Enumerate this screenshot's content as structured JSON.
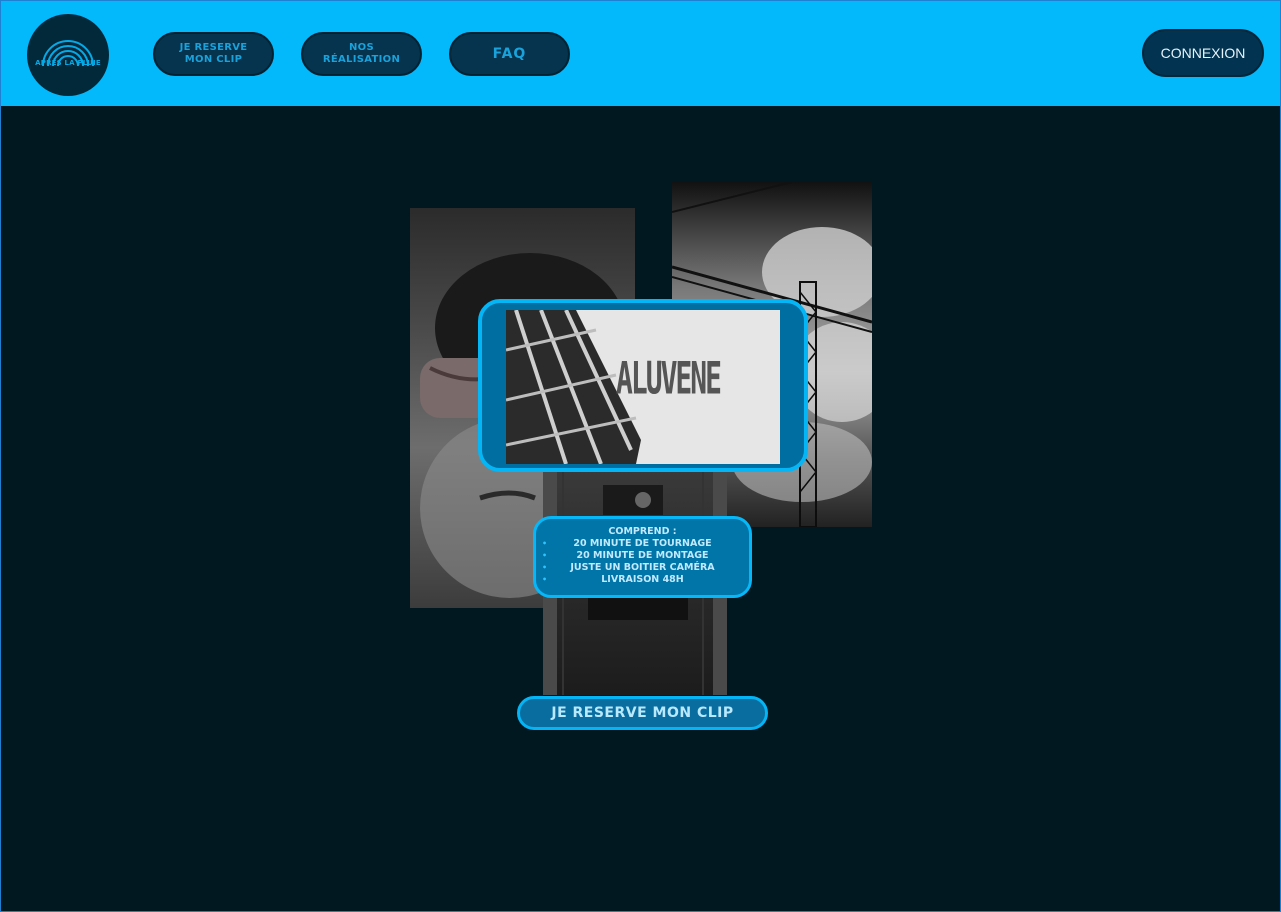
{
  "brand": {
    "logo_text": "APRÈS LA PLUIE"
  },
  "nav": {
    "items": [
      {
        "line1": "JE RESERVE",
        "line2": "MON CLIP"
      },
      {
        "line1": "NOS",
        "line2": "RÉALISATION"
      },
      {
        "line1": "FAQ",
        "line2": ""
      }
    ],
    "login_label": "CONNEXION"
  },
  "video": {
    "thumbnail_title": "ALUVENE"
  },
  "offer": {
    "heading": "COMPREND :",
    "items": [
      "20 MINUTE DE TOURNAGE",
      "20 MINUTE DE MONTAGE",
      "JUSTE UN BOITIER CAMÉRA",
      "LIVRAISON 48H"
    ]
  },
  "cta": {
    "label": "JE RESERVE MON CLIP"
  },
  "colors": {
    "topbar": "#03b8fb",
    "background": "#021821",
    "accent": "#05b6f6",
    "button": "#06334d"
  }
}
